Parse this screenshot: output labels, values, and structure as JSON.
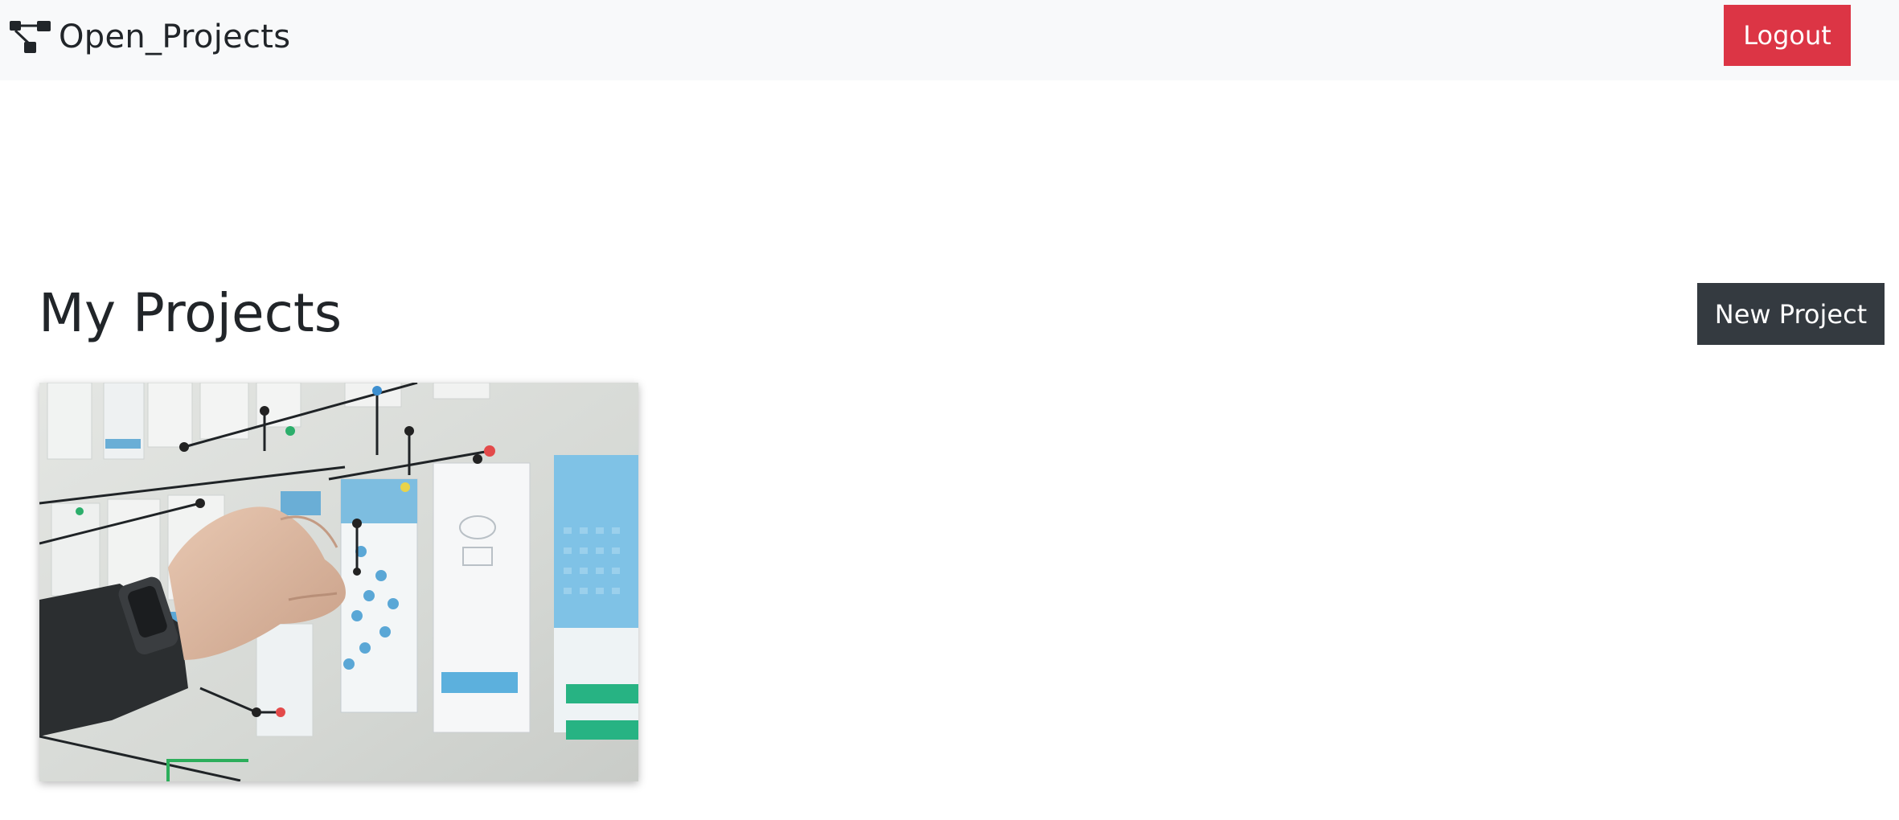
{
  "navbar": {
    "brand_icon": "sitemap-icon",
    "brand_text": "Open_Projects",
    "logout_label": "Logout"
  },
  "main": {
    "title": "My Projects",
    "new_project_label": "New Project",
    "projects": [
      {
        "thumbnail": "project-board-photo"
      }
    ]
  },
  "colors": {
    "navbar_bg": "#f8f9fa",
    "logout_bg": "#dc3545",
    "new_project_bg": "#343a40",
    "text": "#212529"
  }
}
